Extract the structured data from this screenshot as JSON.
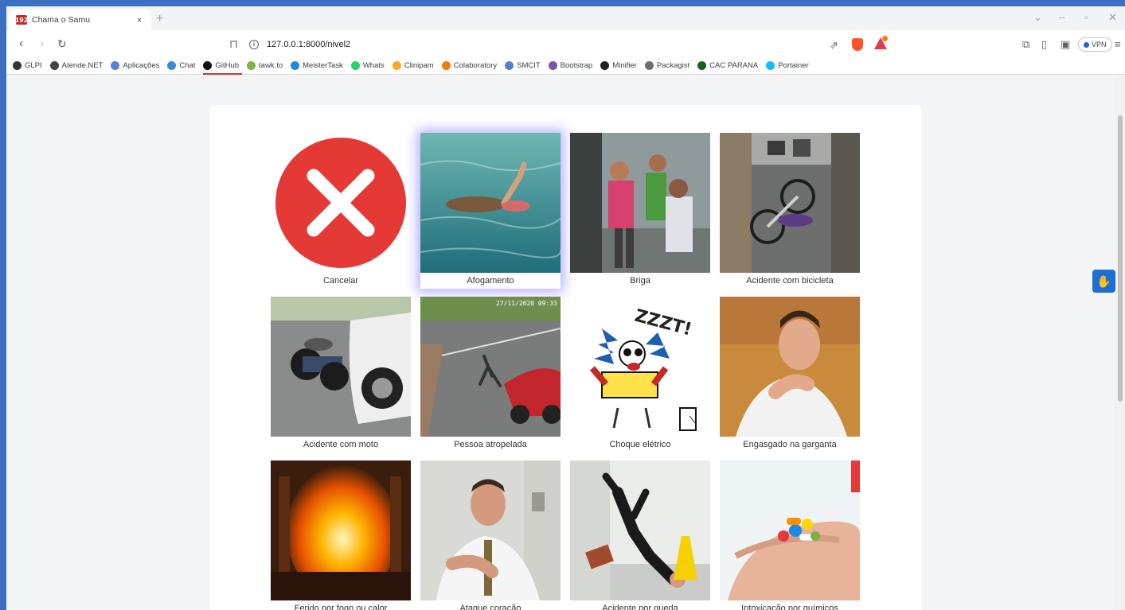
{
  "browser": {
    "tab_title": "Chama o Samu",
    "tab_favicon_text": "192",
    "url": "127.0.0.1:8000/nivel2",
    "vpn_label": "VPN"
  },
  "bookmarks": [
    {
      "label": "GLPI",
      "icon": "glpi-icon",
      "color": "#333333"
    },
    {
      "label": "Atende.NET",
      "icon": "atendenet-icon",
      "color": "#444444"
    },
    {
      "label": "Aplicações",
      "icon": "apps-icon",
      "color": "#5b7fd1"
    },
    {
      "label": "Chat",
      "icon": "chat-icon",
      "color": "#3b8ad9"
    },
    {
      "label": "GitHub",
      "icon": "github-icon",
      "color": "#111111"
    },
    {
      "label": "tawk.to",
      "icon": "tawk-icon",
      "color": "#7cb342"
    },
    {
      "label": "MeisterTask",
      "icon": "meistertask-icon",
      "color": "#1e88e5"
    },
    {
      "label": "Whats",
      "icon": "whatsapp-icon",
      "color": "#25d366"
    },
    {
      "label": "Clinipam",
      "icon": "clinipam-icon",
      "color": "#f9a825"
    },
    {
      "label": "Colaboratory",
      "icon": "colab-icon",
      "color": "#f57c00"
    },
    {
      "label": "SMCIT",
      "icon": "smcit-icon",
      "color": "#5b7fd1"
    },
    {
      "label": "Bootstrap",
      "icon": "bootstrap-icon",
      "color": "#7952b3"
    },
    {
      "label": "Minifier",
      "icon": "minifier-icon",
      "color": "#222222"
    },
    {
      "label": "Packagist",
      "icon": "packagist-icon",
      "color": "#6d6d6d"
    },
    {
      "label": "CAC PARANA",
      "icon": "cac-icon",
      "color": "#1b5e20"
    },
    {
      "label": "Portainer",
      "icon": "portainer-icon",
      "color": "#13bef9"
    }
  ],
  "options": [
    {
      "label": "Cancelar",
      "icon": "cancel-x-icon"
    },
    {
      "label": "Afogamento",
      "icon": "drowning-photo"
    },
    {
      "label": "Briga",
      "icon": "fight-photo"
    },
    {
      "label": "Acidente com bicicleta",
      "icon": "bicycle-accident-photo"
    },
    {
      "label": "Acidente com moto",
      "icon": "motorcycle-accident-photo"
    },
    {
      "label": "Pessoa atropelada",
      "icon": "pedestrian-hit-photo"
    },
    {
      "label": "Choque elétrico",
      "icon": "electric-shock-cartoon"
    },
    {
      "label": "Engasgado na garganta",
      "icon": "choking-photo"
    },
    {
      "label": "Ferido por fogo ou calor",
      "icon": "fire-photo"
    },
    {
      "label": "Ataque coração",
      "icon": "heart-attack-photo"
    },
    {
      "label": "Acidente por queda",
      "icon": "fall-photo"
    },
    {
      "label": "Intoxicação por químicos",
      "icon": "pills-photo"
    }
  ],
  "selected_option": "Afogamento",
  "photo_text": {
    "timestamp": "27/11/2020 09:33",
    "zzzt": "ZZZT!"
  },
  "colors": {
    "accent_red": "#e53935",
    "a11y_blue": "#1b6fd6",
    "page_bg": "#f3f5f7"
  }
}
